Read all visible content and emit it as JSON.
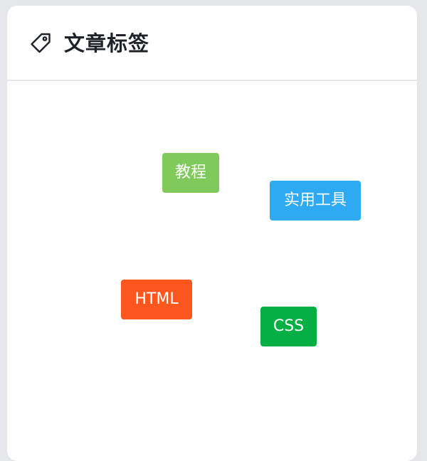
{
  "header": {
    "icon": "tag-icon",
    "title": "文章标签"
  },
  "tags": [
    {
      "label": "教程",
      "color": "#80c95b"
    },
    {
      "label": "实用工具",
      "color": "#2eaaf2"
    },
    {
      "label": "HTML",
      "color": "#fb561d"
    },
    {
      "label": "CSS",
      "color": "#05af43"
    }
  ]
}
